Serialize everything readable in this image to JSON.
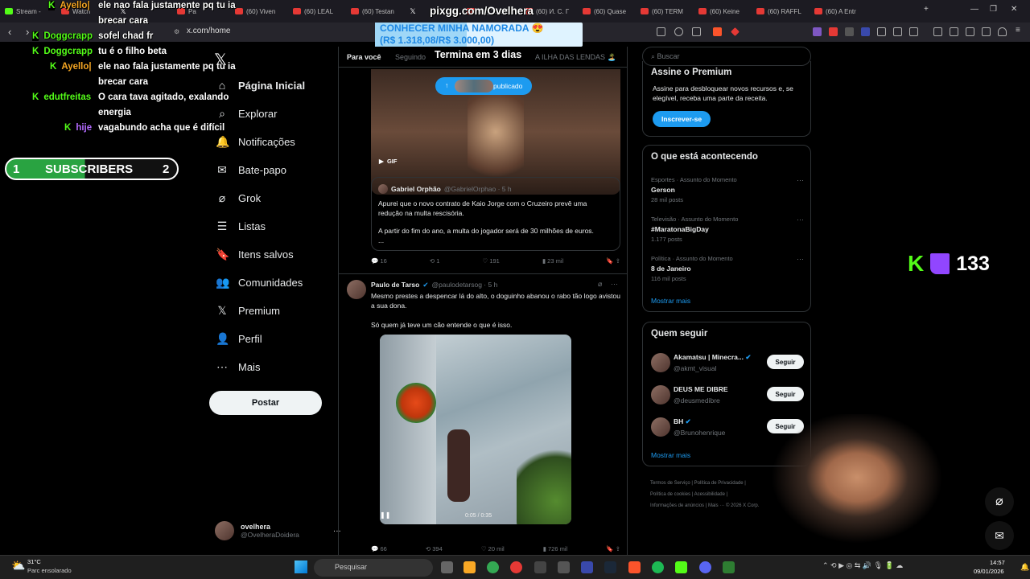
{
  "browser": {
    "tabs": [
      {
        "label": "Stream -",
        "icon": "kick"
      },
      {
        "label": "Watch",
        "icon": "generic"
      },
      {
        "label": "",
        "icon": "x"
      },
      {
        "label": "Pa",
        "icon": "youtube"
      },
      {
        "label": "(60) Viven",
        "icon": "youtube"
      },
      {
        "label": "(60) LEAL",
        "icon": "youtube"
      },
      {
        "label": "(60) Testan",
        "icon": "youtube"
      },
      {
        "label": "",
        "icon": "x"
      },
      {
        "label": "(60) \"O DE",
        "icon": "youtube"
      },
      {
        "label": "(60) И. С. Г",
        "icon": "youtube"
      },
      {
        "label": "(60) Quase",
        "icon": "youtube"
      },
      {
        "label": "(60) TERM",
        "icon": "youtube"
      },
      {
        "label": "(60) Keine",
        "icon": "youtube"
      },
      {
        "label": "(60) RAFFL",
        "icon": "youtube"
      },
      {
        "label": "(60) A Entr",
        "icon": "youtube"
      }
    ],
    "url": "x.com/home"
  },
  "overlay": {
    "pixgg": "pixgg.com/Ovelhera",
    "banner_line1": "CONHECER MINHA NAMORADA 😍",
    "banner_line2": "(R$ 1.318,08/R$ 3.000,00)",
    "goal_progress": 0.44,
    "countdown": "Termina em 3 dias",
    "subs_left": "1",
    "subs_label": "SUBSCRIBERS",
    "subs_right": "2",
    "viewer_count": "133",
    "chat": [
      {
        "user": "Ayello|",
        "text": "ele nao fala justamente pq tu ia",
        "color": "#f5a623"
      },
      {
        "user": "",
        "text": "brecar cara",
        "color": "#fff"
      },
      {
        "user": "Doggcrapp",
        "text": "sofel chad fr",
        "color": "#53fc18"
      },
      {
        "user": "Doggcrapp",
        "text": "tu é o filho beta",
        "color": "#53fc18"
      },
      {
        "user": "Ayello|",
        "text": "ele nao fala justamente pq tu ia",
        "color": "#f5a623"
      },
      {
        "user": "",
        "text": "brecar cara",
        "color": "#fff"
      },
      {
        "user": "edutfreitas",
        "text": "O cara tava agitado, exalando",
        "color": "#53fc18"
      },
      {
        "user": "",
        "text": "energia",
        "color": "#fff"
      },
      {
        "user": "hije",
        "text": "vagabundo acha que é difícil",
        "color": "#b36bff"
      }
    ]
  },
  "sidebar": {
    "items": [
      {
        "label": "Página Inicial",
        "icon": "home-icon"
      },
      {
        "label": "Explorar",
        "icon": "search-icon"
      },
      {
        "label": "Notificações",
        "icon": "bell-icon"
      },
      {
        "label": "Bate-papo",
        "icon": "mail-icon"
      },
      {
        "label": "Grok",
        "icon": "grok-icon"
      },
      {
        "label": "Listas",
        "icon": "list-icon"
      },
      {
        "label": "Itens salvos",
        "icon": "bookmark-icon"
      },
      {
        "label": "Comunidades",
        "icon": "people-icon"
      },
      {
        "label": "Premium",
        "icon": "x-icon"
      },
      {
        "label": "Perfil",
        "icon": "person-icon"
      },
      {
        "label": "Mais",
        "icon": "more-icon"
      }
    ],
    "post_label": "Postar",
    "profile_name": "ovelhera",
    "profile_handle": "@OvelheraDoidera"
  },
  "feed": {
    "tabs": [
      "Para você",
      "Seguindo",
      "A ILHA DAS LENDAS 🏝️"
    ],
    "published_pill": "publicado",
    "gif_label": "GIF",
    "quote": {
      "name": "Gabriel Orphão",
      "handle": "@GabrielOrphao · 5 h",
      "text1": "Apurei que o novo contrato de Kaio Jorge com o Cruzeiro prevê uma redução na multa rescisória.",
      "text2": "A partir do fim do ano, a multa do jogador será de 30 milhões de euros.",
      "ellipsis": "..."
    },
    "post1_stats": {
      "replies": "16",
      "reposts": "1",
      "likes": "191",
      "views": "23 mil"
    },
    "post2": {
      "name": "Paulo de Tarso",
      "handle": "@paulodetarsog · 5 h",
      "text1": "Mesmo prestes a despencar lá do alto, o doguinho abanou o rabo tão logo avistou a sua dona.",
      "text2": "Só quem já teve um cão entende o que é isso.",
      "video_time": "0:05 / 0:35"
    },
    "post2_stats": {
      "replies": "66",
      "reposts": "394",
      "likes": "20 mil",
      "views": "726 mil"
    }
  },
  "right": {
    "search_placeholder": "Buscar",
    "premium_title": "Assine o Premium",
    "premium_text": "Assine para desbloquear novos recursos e, se elegível, receba uma parte da receita.",
    "premium_button": "Inscrever-se",
    "trends_title": "O que está acontecendo",
    "trends": [
      {
        "context": "Esportes · Assunto do Momento",
        "name": "Gerson",
        "posts": "28 mil posts"
      },
      {
        "context": "Televisão · Assunto do Momento",
        "name": "#MaratonaBigDay",
        "posts": "1.177 posts"
      },
      {
        "context": "Política · Assunto do Momento",
        "name": "8 de Janeiro",
        "posts": "116 mil posts"
      }
    ],
    "show_more": "Mostrar mais",
    "follow_title": "Quem seguir",
    "follow": [
      {
        "name": "Akamatsu | Minecra...",
        "handle": "@akmt_visual",
        "verified": true
      },
      {
        "name": "DEUS ME DIBRE",
        "handle": "@deusmedibre",
        "verified": false
      },
      {
        "name": "BH",
        "handle": "@Brunohenrique",
        "verified": true
      }
    ],
    "follow_button": "Seguir",
    "footer1": "Termos de Serviço",
    "footer2": "Política de Privacidade",
    "footer3": "Política de cookies",
    "footer4": "Acessibilidade",
    "footer5": "Informações de anúncios",
    "footer6": "Mais ···",
    "footer7": "© 2026 X Corp."
  },
  "taskbar": {
    "temp": "31°C",
    "weather": "Parc ensolarado",
    "search": "Pesquisar",
    "time": "14:57",
    "date": "09/01/2026"
  },
  "colors": {
    "accent": "#1d9bf0",
    "kick": "#53fc18",
    "twitch": "#9146ff"
  }
}
